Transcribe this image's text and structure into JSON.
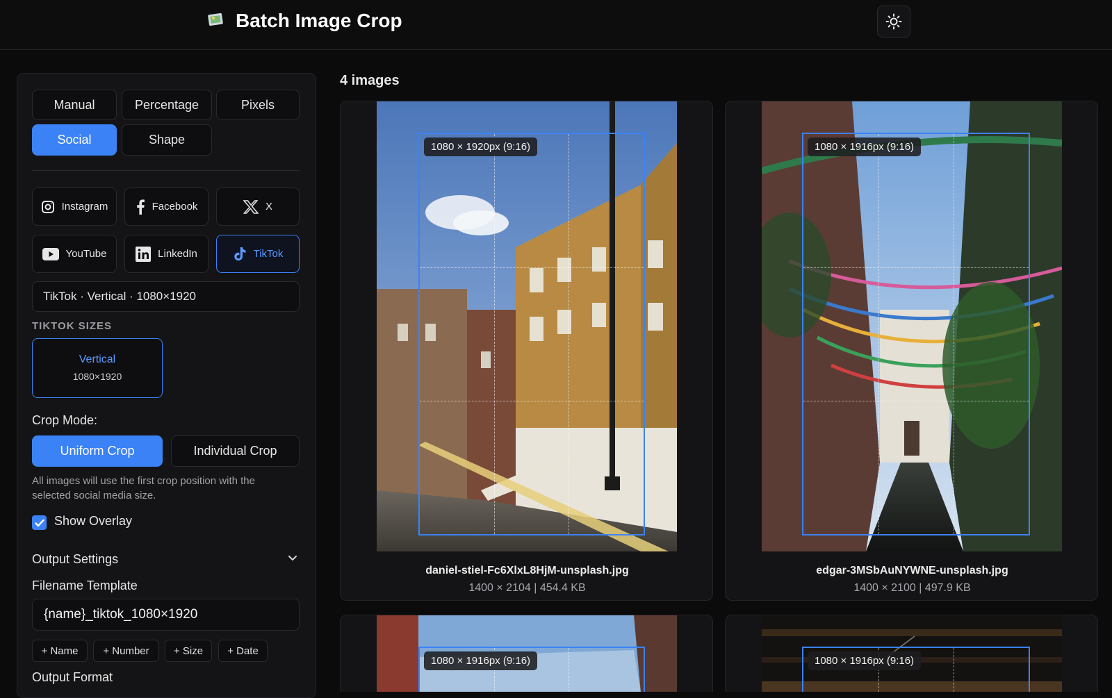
{
  "header": {
    "title": "Batch Image Crop"
  },
  "tabs": [
    "Manual",
    "Percentage",
    "Pixels",
    "Social",
    "Shape"
  ],
  "social": {
    "platforms": [
      "Instagram",
      "Facebook",
      "X",
      "YouTube",
      "LinkedIn",
      "TikTok"
    ],
    "selected": "TikTok",
    "preset_display": "TikTok · Vertical · 1080×1920",
    "sizes_label": "TIKTOK SIZES",
    "size": {
      "name": "Vertical",
      "dims": "1080×1920"
    }
  },
  "crop_mode": {
    "label": "Crop Mode:",
    "uniform": "Uniform Crop",
    "individual": "Individual Crop",
    "help": "All images will use the first crop position with the selected social media size."
  },
  "overlay": {
    "label": "Show Overlay",
    "checked": true
  },
  "output": {
    "title": "Output Settings",
    "filename_label": "Filename Template",
    "filename_value": "{name}_tiktok_1080×1920",
    "chips": [
      "+ Name",
      "+ Number",
      "+ Size",
      "+ Date"
    ],
    "format_label": "Output Format"
  },
  "gallery": {
    "count_label": "4 images",
    "images": [
      {
        "badge": "1080 × 1920px (9:16)",
        "filename": "daniel-stiel-Fc6XlxL8HjM-unsplash.jpg",
        "meta": "1400 × 2104 | 454.4 KB"
      },
      {
        "badge": "1080 × 1916px (9:16)",
        "filename": "edgar-3MSbAuNYWNE-unsplash.jpg",
        "meta": "1400 × 2100 | 497.9 KB"
      },
      {
        "badge": "1080 × 1916px (9:16)"
      },
      {
        "badge": "1080 × 1916px (9:16)"
      }
    ]
  },
  "colors": {
    "accent": "#3b82f6",
    "background": "#0b0b0c",
    "panel": "#141416"
  }
}
